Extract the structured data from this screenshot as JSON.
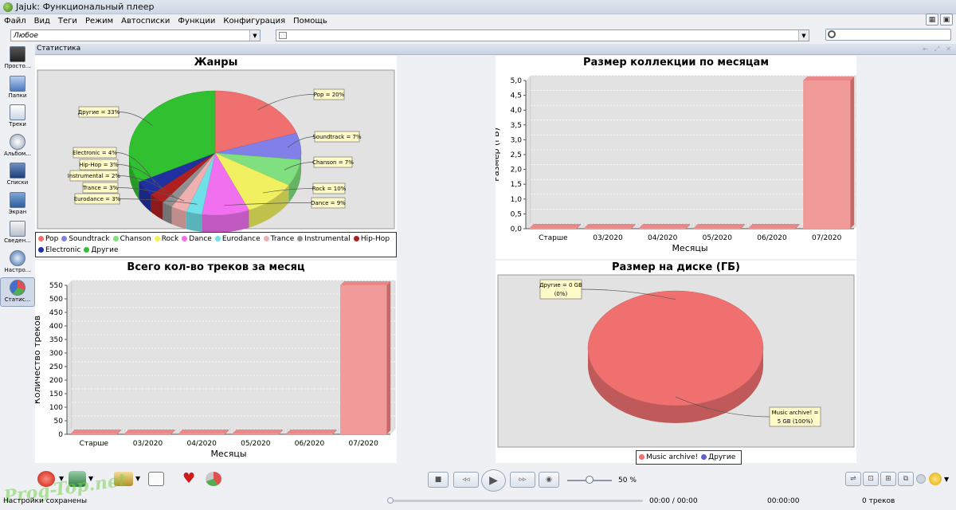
{
  "window": {
    "title": "Jajuk: Функциональный плеер"
  },
  "menu": [
    "Файл",
    "Вид",
    "Теги",
    "Режим",
    "Автосписки",
    "Функции",
    "Конфигурация",
    "Помощь"
  ],
  "filters": {
    "ambience_value": "Любое",
    "query_value": "",
    "search_placeholder": ""
  },
  "sidebar": {
    "items": [
      {
        "label": "Просто...",
        "icon": "simple-view-icon"
      },
      {
        "label": "Папки",
        "icon": "folder-icon"
      },
      {
        "label": "Треки",
        "icon": "tracks-icon"
      },
      {
        "label": "Альбом...",
        "icon": "album-icon"
      },
      {
        "label": "Списки",
        "icon": "playlist-icon"
      },
      {
        "label": "Экран",
        "icon": "display-icon"
      },
      {
        "label": "Сведен...",
        "icon": "info-icon"
      },
      {
        "label": "Настро...",
        "icon": "gear-icon"
      },
      {
        "label": "Статис...",
        "icon": "statistics-icon"
      }
    ]
  },
  "tab": {
    "label": "Статистика"
  },
  "player": {
    "volume": "50 %"
  },
  "status": {
    "message": "Настройки сохранены",
    "elapsed": "00:00 / 00:00",
    "remaining": "00:00:00",
    "tracks": "0 треков"
  },
  "watermark": "Prog-Top.net",
  "chart_data": [
    {
      "type": "pie",
      "title": "Жанры",
      "labels": [
        "Pop",
        "Soundtrack",
        "Chanson",
        "Rock",
        "Dance",
        "Eurodance",
        "Trance",
        "Instrumental",
        "Hip-Hop",
        "Electronic",
        "Другие"
      ],
      "legend_labels": [
        "Pop",
        "Soundtrack",
        "Chanson",
        "Rock",
        "Dance",
        "Eurodance",
        "Trance",
        "Instrumental",
        "Hip-Hop",
        "Electronic",
        "Другие"
      ],
      "values": [
        20,
        7,
        7,
        10,
        9,
        3,
        3,
        2,
        3,
        4,
        33
      ],
      "colors": [
        "#f07070",
        "#8080e8",
        "#80e080",
        "#f0f060",
        "#f070f0",
        "#70e0e8",
        "#f0b0b0",
        "#909090",
        "#b02020",
        "#2030a0",
        "#30c030"
      ],
      "annotations": [
        "Pop = 20%",
        "Soundtrack = 7%",
        "Chanson = 7%",
        "Rock = 10%",
        "Dance = 9%",
        "Eurodance = 3%",
        "Trance = 3%",
        "Instrumental = 2%",
        "Hip-Hop = 3%",
        "Electronic = 4%",
        "Другие = 33%"
      ]
    },
    {
      "type": "bar",
      "title": "Размер коллекции по месяцам",
      "xlabel": "Месяцы",
      "ylabel": "Размер (ГБ)",
      "categories": [
        "Старше",
        "03/2020",
        "04/2020",
        "05/2020",
        "06/2020",
        "07/2020"
      ],
      "values": [
        0,
        0,
        0,
        0,
        0,
        5
      ],
      "ylim": [
        0,
        5.0
      ],
      "yticks": [
        "0,0",
        "0,5",
        "1,0",
        "1,5",
        "2,0",
        "2,5",
        "3,0",
        "3,5",
        "4,0",
        "4,5",
        "5,0"
      ]
    },
    {
      "type": "bar",
      "title": "Всего кол-во треков за месяц",
      "xlabel": "Месяцы",
      "ylabel": "Количество треков",
      "categories": [
        "Старше",
        "03/2020",
        "04/2020",
        "05/2020",
        "06/2020",
        "07/2020"
      ],
      "values": [
        0,
        0,
        0,
        0,
        0,
        550
      ],
      "ylim": [
        0,
        550
      ],
      "yticks": [
        "0",
        "50",
        "100",
        "150",
        "200",
        "250",
        "300",
        "350",
        "400",
        "450",
        "500",
        "550"
      ]
    },
    {
      "type": "pie",
      "title": "Размер на диске (ГБ)",
      "labels": [
        "Music archive!",
        "Другие"
      ],
      "values": [
        5,
        0
      ],
      "colors": [
        "#f07070",
        "#6060d0"
      ],
      "annotations": [
        [
          "Music archive! =",
          "5 GB (100%)"
        ],
        [
          "Другие = 0 GB",
          "(0%)"
        ]
      ]
    }
  ]
}
